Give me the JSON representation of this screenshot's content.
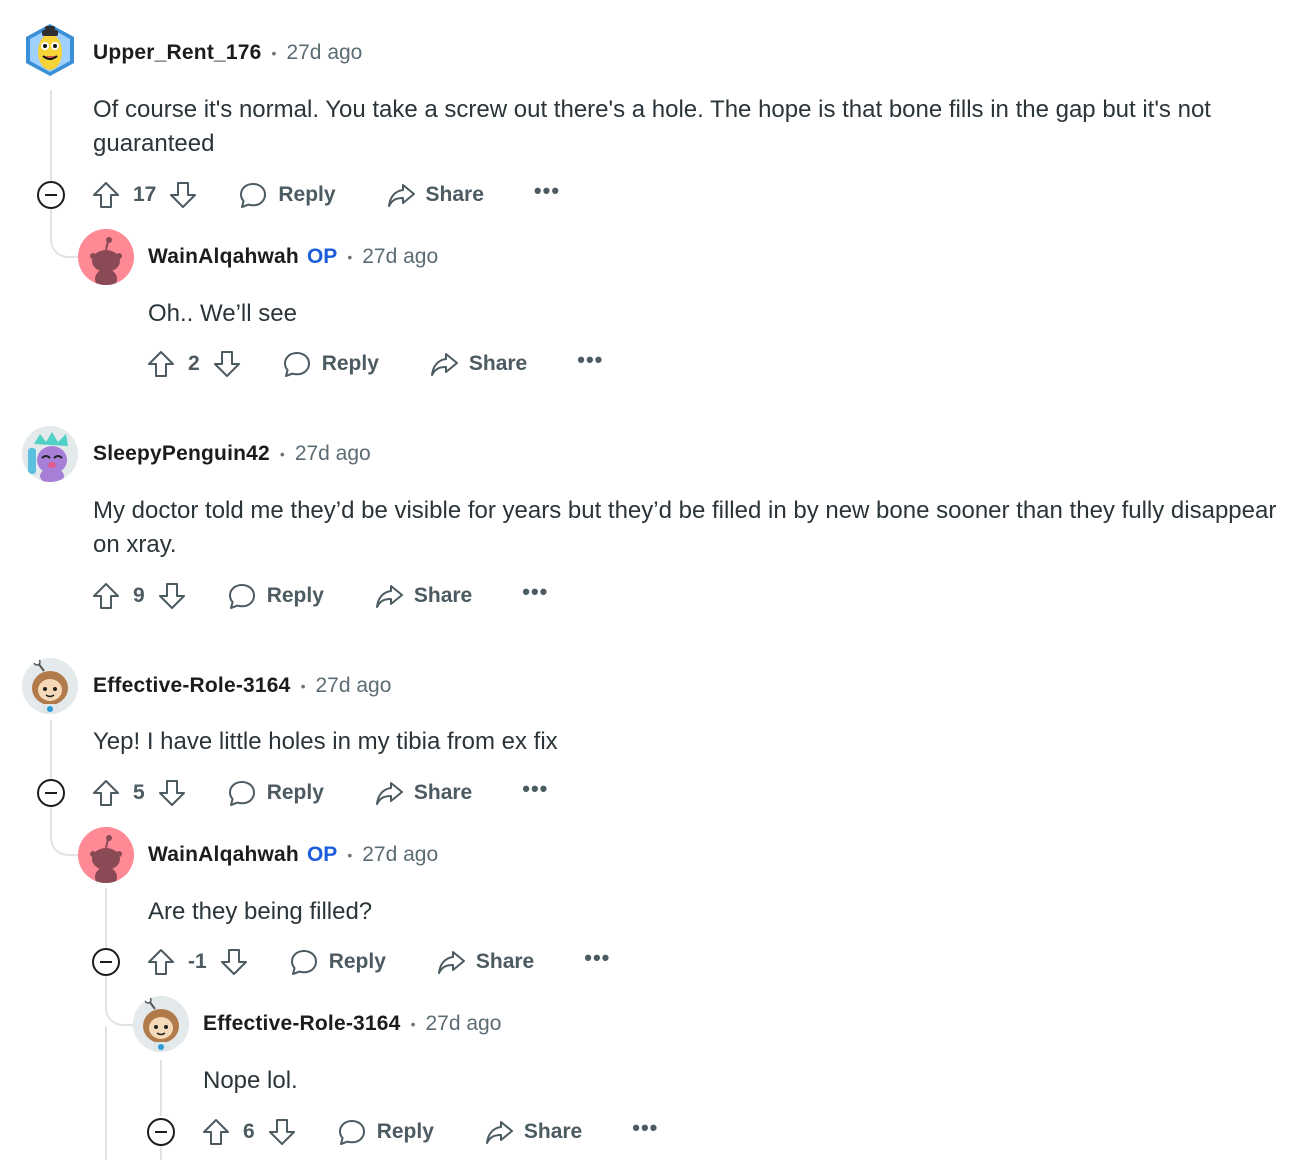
{
  "comments": [
    {
      "author": "Upper_Rent_176",
      "time": "27d ago",
      "text": "Of course it's normal. You take a screw out there's a hole. The hope is that bone fills in the gap but it's not guaranteed",
      "score": "17",
      "reply_label": "Reply",
      "share_label": "Share",
      "more_label": "•••"
    },
    {
      "author": "WainAlqahwah",
      "op_label": "OP",
      "time": "27d ago",
      "text": "Oh.. We’ll see",
      "score": "2",
      "reply_label": "Reply",
      "share_label": "Share",
      "more_label": "•••"
    },
    {
      "author": "SleepyPenguin42",
      "time": "27d ago",
      "text": "My doctor told me they’d be visible for years but they’d be filled in by new bone sooner than they fully disappear on xray.",
      "score": "9",
      "reply_label": "Reply",
      "share_label": "Share",
      "more_label": "•••"
    },
    {
      "author": "Effective-Role-3164",
      "time": "27d ago",
      "text": "Yep! I have little holes in my tibia from ex fix",
      "score": "5",
      "reply_label": "Reply",
      "share_label": "Share",
      "more_label": "•••"
    },
    {
      "author": "WainAlqahwah",
      "op_label": "OP",
      "time": "27d ago",
      "text": "Are they being filled?",
      "score": "-1",
      "reply_label": "Reply",
      "share_label": "Share",
      "more_label": "•••"
    },
    {
      "author": "Effective-Role-3164",
      "time": "27d ago",
      "text": "Nope lol.",
      "score": "6",
      "reply_label": "Reply",
      "share_label": "Share",
      "more_label": "•••"
    }
  ],
  "icons": {
    "upvote": "upvote-arrow-icon",
    "downvote": "downvote-arrow-icon",
    "reply": "speech-bubble-icon",
    "share": "share-arrow-icon",
    "more": "ellipsis-icon",
    "collapse": "collapse-minus-icon"
  },
  "colors": {
    "op_badge": "#1d5ddb",
    "thread_line": "#dfe3e6",
    "action_text": "#4c5a61",
    "op_avatar_bg": "#ff8a95"
  }
}
